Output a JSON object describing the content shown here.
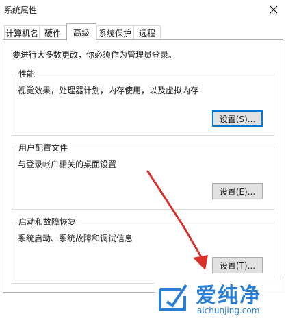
{
  "window": {
    "title": "系统属性"
  },
  "tabs": [
    {
      "label": "计算机名"
    },
    {
      "label": "硬件"
    },
    {
      "label": "高级",
      "active": true
    },
    {
      "label": "系统保护"
    },
    {
      "label": "远程"
    }
  ],
  "admin_note": "要进行大多数更改，你必须作为管理员登录。",
  "groups": {
    "performance": {
      "title": "性能",
      "description": "视觉效果，处理器计划，内存使用，以及虚拟内存",
      "button": "设置(S)..."
    },
    "user_profiles": {
      "title": "用户配置文件",
      "description": "与登录帐户相关的桌面设置",
      "button": "设置(E)..."
    },
    "startup_recovery": {
      "title": "启动和故障恢复",
      "description": "系统启动、系统故障和调试信息",
      "button": "设置(T)..."
    }
  },
  "watermark": {
    "name": "爱纯净",
    "url": "aichunjing.com"
  },
  "colors": {
    "accent": "#0078d7",
    "arrow": "#d9302a",
    "watermark": "#2a7fd4"
  }
}
